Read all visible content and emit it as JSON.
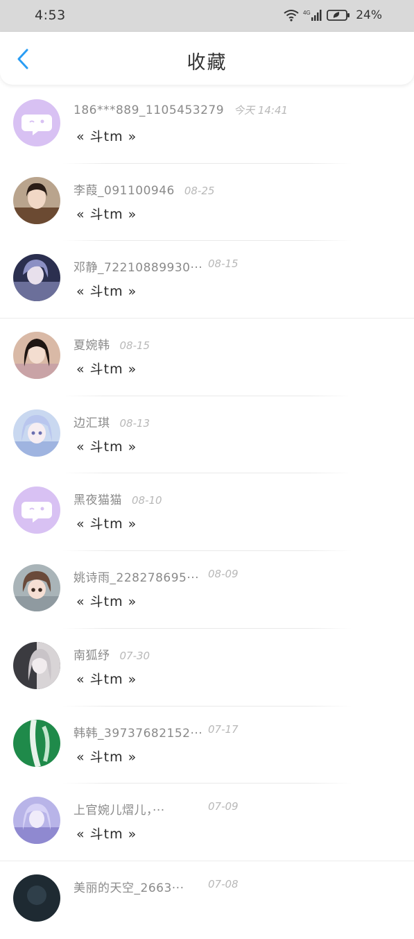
{
  "status_bar": {
    "time": "4:53",
    "network": "4G",
    "battery": "24%"
  },
  "header": {
    "title": "收藏"
  },
  "colors": {
    "accent": "#2a9df4",
    "default_avatar_bg": "#d8c1f3"
  },
  "favorites": [
    {
      "sender": "186***889_1105453279",
      "date": "今天 14:41",
      "content": "« 斗tm »",
      "avatar": "default-bot-avatar"
    },
    {
      "sender": "李葭_091100946",
      "date": "08-25",
      "content": "« 斗tm »",
      "avatar": "photo-avatar"
    },
    {
      "sender": "邓静_72210889930···",
      "date": "08-15",
      "content": "« 斗tm »",
      "avatar": "anime-avatar"
    },
    {
      "sender": "夏婉韩",
      "date": "08-15",
      "content": "« 斗tm »",
      "avatar": "photo-avatar"
    },
    {
      "sender": "边汇琪",
      "date": "08-13",
      "content": "« 斗tm »",
      "avatar": "anime-avatar"
    },
    {
      "sender": "黑夜猫猫",
      "date": "08-10",
      "content": "« 斗tm »",
      "avatar": "default-bot-avatar"
    },
    {
      "sender": "姚诗雨_228278695···",
      "date": "08-09",
      "content": "« 斗tm »",
      "avatar": "anime-avatar"
    },
    {
      "sender": "南狐纾",
      "date": "07-30",
      "content": "« 斗tm »",
      "avatar": "anime-avatar"
    },
    {
      "sender": "韩韩_39737682152···",
      "date": "07-17",
      "content": "« 斗tm »",
      "avatar": "photo-avatar"
    },
    {
      "sender": "上官婉儿熠儿，···",
      "date": "07-09",
      "content": "« 斗tm »",
      "avatar": "anime-avatar"
    },
    {
      "sender": "美丽的天空_2663···",
      "date": "07-08",
      "content": "",
      "avatar": "photo-avatar"
    }
  ]
}
